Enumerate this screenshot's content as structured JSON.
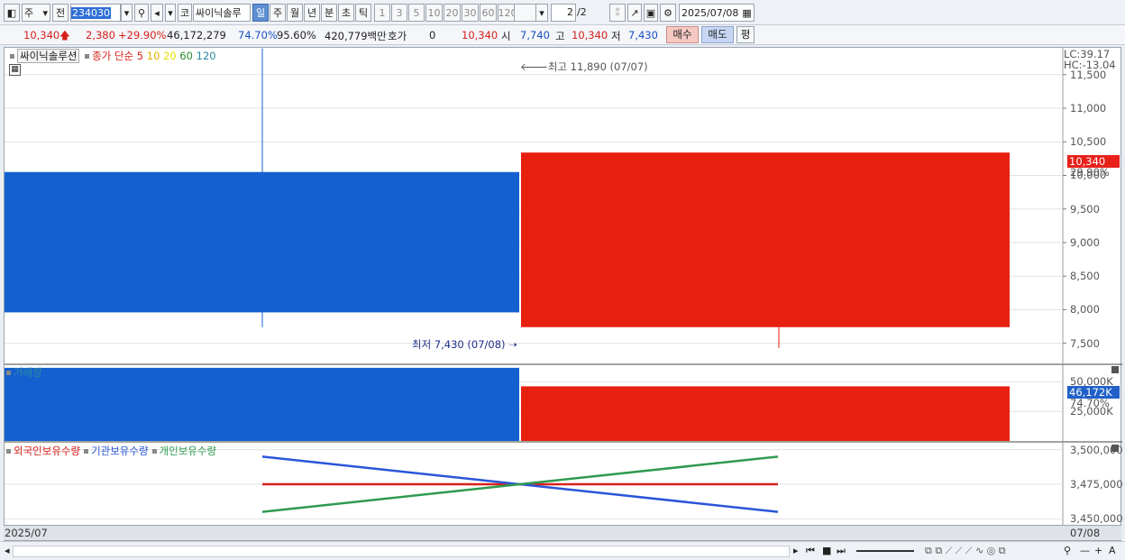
{
  "toolbar": {
    "type_label": "주",
    "prev_label": "전",
    "code": "234030",
    "market_label": "코",
    "stock_name": "싸이닉솔루",
    "periods": [
      "일",
      "주",
      "월",
      "년",
      "분",
      "초",
      "틱"
    ],
    "active_period": "일",
    "intervals": [
      "1",
      "3",
      "5",
      "10",
      "20",
      "30",
      "60",
      "120"
    ],
    "page": "2",
    "page_total": "/2",
    "date": "2025/07/08"
  },
  "info": {
    "price": "10,340",
    "change": "2,380",
    "change_pct": "+29.90%",
    "volume": "46,172,279",
    "turnover_pct": "74.70%",
    "ratio_pct": "95.60%",
    "amount": "420,779백만",
    "quote_label": "호가",
    "quote_value": "0",
    "quote_price": "10,340",
    "open_label": "시",
    "open": "7,740",
    "high_label": "고",
    "high": "10,340",
    "low_label": "저",
    "low": "7,430",
    "buy_label": "매수",
    "sell_label": "매도",
    "eval_label": "평"
  },
  "price_panel": {
    "name_tag": "싸이닉솔루션",
    "ma_label": "종가 단순",
    "ma_periods": [
      "5",
      "10",
      "20",
      "60",
      "120"
    ],
    "ma_colors": [
      "#d8201a",
      "#e8b000",
      "#e8e000",
      "#2a8a2a",
      "#2a8aa0"
    ],
    "lc": "LC:39.17",
    "hc": "HC:-13.04",
    "high_note": "최고 11,890 (07/07)",
    "low_note": "최저 7,430 (07/08)",
    "y_ticks": [
      "11,500",
      "11,000",
      "10,500",
      "10,000",
      "9,500",
      "9,000",
      "8,500",
      "8,000",
      "7,500"
    ],
    "current_tag": "10,340",
    "current_pct": "29.90%"
  },
  "volume_panel": {
    "title": "거래량",
    "y_ticks": [
      "50,000K",
      "25,000K"
    ],
    "current_tag": "46,172K",
    "current_pct": "74.70%"
  },
  "holding_panel": {
    "series": [
      "외국인보유수량",
      "기관보유수량",
      "개인보유수량"
    ],
    "series_colors": [
      "#d8201a",
      "#2a55d8",
      "#2f9a50"
    ],
    "y_ticks": [
      "3,500,000",
      "3,475,000",
      "3,450,000"
    ]
  },
  "date_axis": {
    "left": "2025/07",
    "right": "07/08"
  },
  "chart_data": {
    "type": "candlestick",
    "dates": [
      "07/07",
      "07/08"
    ],
    "ohlc": [
      {
        "date": "07/07",
        "open": 10050,
        "high": 11890,
        "low": 7740,
        "close": 7960
      },
      {
        "date": "07/08",
        "open": 7740,
        "high": 10340,
        "low": 7430,
        "close": 10340
      }
    ],
    "price_ylim": [
      7200,
      11900
    ],
    "volume": [
      {
        "date": "07/07",
        "value": 61800
      },
      {
        "date": "07/08",
        "value": 46172
      }
    ],
    "volume_unit": "K",
    "volume_ylim": [
      0,
      64000
    ],
    "holdings": [
      {
        "name": "외국인보유수량",
        "values": [
          3475000,
          3475000
        ]
      },
      {
        "name": "기관보유수량",
        "values": [
          3495000,
          3455000
        ]
      },
      {
        "name": "개인보유수량",
        "values": [
          3455000,
          3495000
        ]
      }
    ],
    "holdings_ylim": [
      3445000,
      3505000
    ],
    "grid": true
  }
}
